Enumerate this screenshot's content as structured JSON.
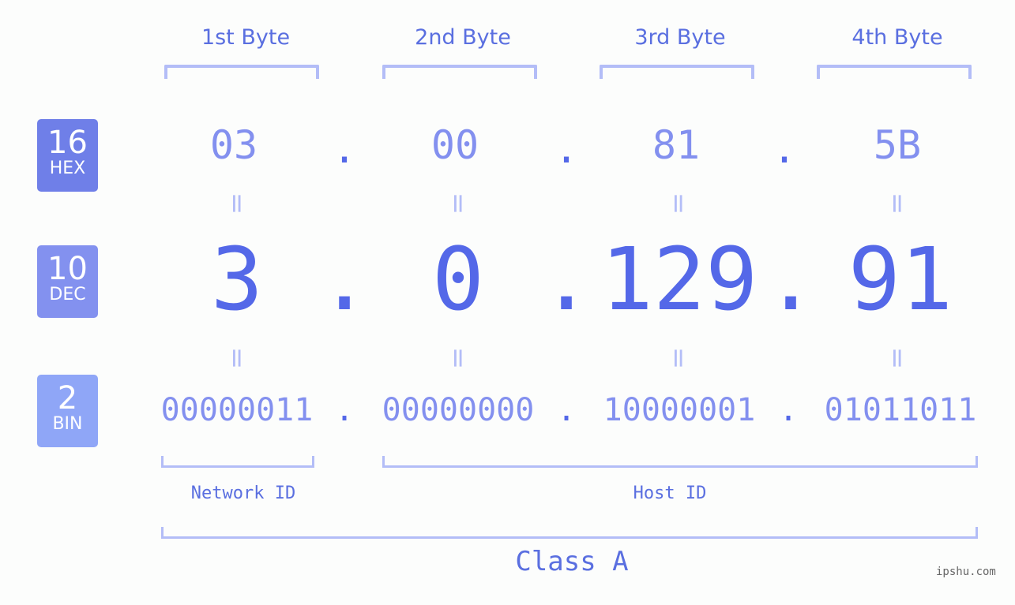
{
  "bytes": [
    {
      "label": "1st Byte",
      "hex": "03",
      "dec": "3",
      "bin": "00000011"
    },
    {
      "label": "2nd Byte",
      "hex": "00",
      "dec": "0",
      "bin": "00000000"
    },
    {
      "label": "3rd Byte",
      "hex": "81",
      "dec": "129",
      "bin": "10000001"
    },
    {
      "label": "4th Byte",
      "hex": "5B",
      "dec": "91",
      "bin": "01011011"
    }
  ],
  "badges": {
    "hex": {
      "num": "16",
      "txt": "HEX",
      "color": "#6f7fe8"
    },
    "dec": {
      "num": "10",
      "txt": "DEC",
      "color": "#8391ef"
    },
    "bin": {
      "num": "2",
      "txt": "BIN",
      "color": "#8fa6f7"
    }
  },
  "separator": ".",
  "equals": "=",
  "network_id_label": "Network ID",
  "host_id_label": "Host ID",
  "class_label": "Class A",
  "footer": "ipshu.com"
}
